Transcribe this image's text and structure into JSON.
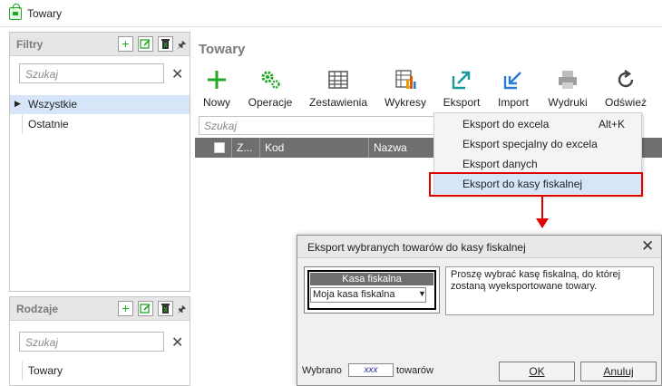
{
  "window": {
    "title": "Towary"
  },
  "filters_panel": {
    "title": "Filtry",
    "search_placeholder": "Szukaj",
    "items": [
      {
        "label": "Wszystkie",
        "selected": true
      },
      {
        "label": "Ostatnie",
        "selected": false
      }
    ]
  },
  "types_panel": {
    "title": "Rodzaje",
    "search_placeholder": "Szukaj",
    "items": [
      {
        "label": "Towary"
      }
    ]
  },
  "main": {
    "title": "Towary",
    "toolbar": [
      {
        "label": "Nowy",
        "icon": "plus-icon"
      },
      {
        "label": "Operacje",
        "icon": "gears-icon"
      },
      {
        "label": "Zestawienia",
        "icon": "table-icon"
      },
      {
        "label": "Wykresy",
        "icon": "chart-icon"
      },
      {
        "label": "Eksport",
        "icon": "export-icon"
      },
      {
        "label": "Import",
        "icon": "import-icon"
      },
      {
        "label": "Wydruki",
        "icon": "printer-icon"
      },
      {
        "label": "Odśwież",
        "icon": "refresh-icon"
      }
    ],
    "grid_search_placeholder": "Szukaj",
    "columns": [
      "Z...",
      "Kod",
      "Nazwa"
    ]
  },
  "export_menu": {
    "items": [
      {
        "label": "Eksport do excela",
        "shortcut": "Alt+K"
      },
      {
        "label": "Eksport specjalny do excela",
        "shortcut": ""
      },
      {
        "label": "Eksport danych",
        "shortcut": ""
      },
      {
        "label": "Eksport do kasy fiskalnej",
        "shortcut": "",
        "highlighted": true
      }
    ]
  },
  "dialog": {
    "title": "Eksport wybranych towarów do kasy fiskalnej",
    "kasa_header": "Kasa fiskalna",
    "kasa_selected": "Moja kasa fiskalna",
    "info_text": "Proszę wybrać kasę fiskalną, do której zostaną wyeksportowane towary.",
    "selected_label": "Wybrano",
    "selected_value": "xxx",
    "items_label": "towarów",
    "ok_label": "OK",
    "cancel_label": "Anuluj"
  },
  "colors": {
    "accent_green": "#22a822",
    "highlight_red": "#e00000",
    "menu_highlight": "#d6e6f8"
  }
}
